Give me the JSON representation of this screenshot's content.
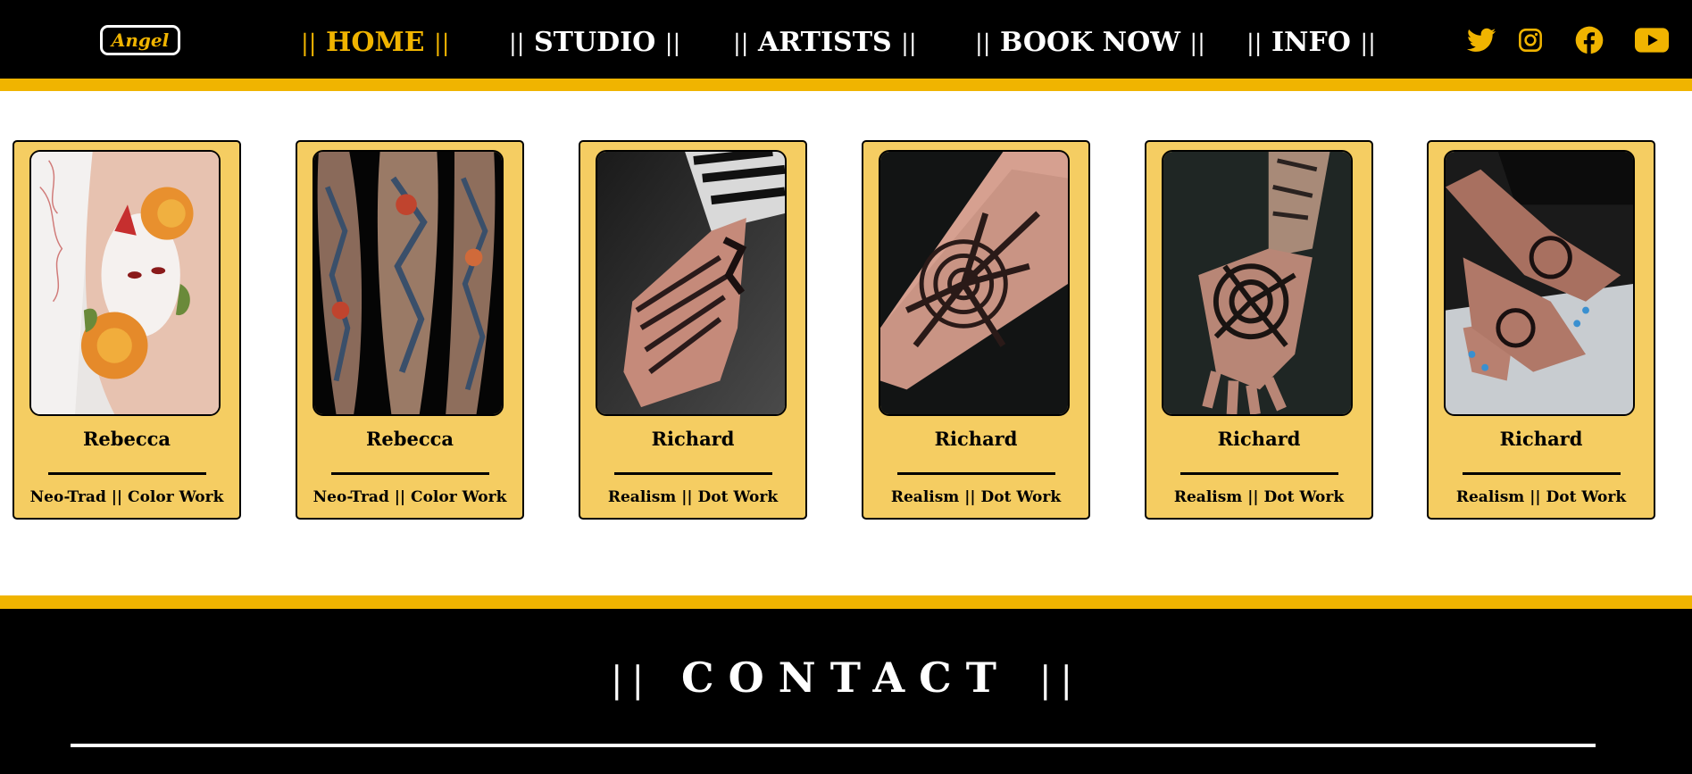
{
  "header": {
    "logo": "Angel",
    "nav": [
      {
        "label": "HOME",
        "active": true
      },
      {
        "label": "STUDIO",
        "active": false
      },
      {
        "label": "ARTISTS",
        "active": false
      },
      {
        "label": "BOOK NOW",
        "active": false
      },
      {
        "label": "INFO",
        "active": false
      }
    ],
    "nav_separator": "||",
    "social_icons": [
      "twitter-icon",
      "instagram-icon",
      "facebook-icon",
      "youtube-icon"
    ]
  },
  "artists": [
    {
      "name": "Rebecca",
      "style": "Neo-Trad || Color Work",
      "image": "fox-mask-peony-tattoo"
    },
    {
      "name": "Rebecca",
      "style": "Neo-Trad || Color Work",
      "image": "japanese-sleeves-tattoo"
    },
    {
      "name": "Richard",
      "style": "Realism || Dot Work",
      "image": "hand-blackwork-tattoo"
    },
    {
      "name": "Richard",
      "style": "Realism || Dot Work",
      "image": "forearm-spiral-tattoo"
    },
    {
      "name": "Richard",
      "style": "Realism || Dot Work",
      "image": "hand-spiral-tattoo"
    },
    {
      "name": "Richard",
      "style": "Realism || Dot Work",
      "image": "hands-knee-tattoo"
    }
  ],
  "contact": {
    "title": "CONTACT",
    "title_separator": "||"
  },
  "colors": {
    "accent": "#f0b400",
    "card": "#f5cd62",
    "dark": "#000000"
  }
}
